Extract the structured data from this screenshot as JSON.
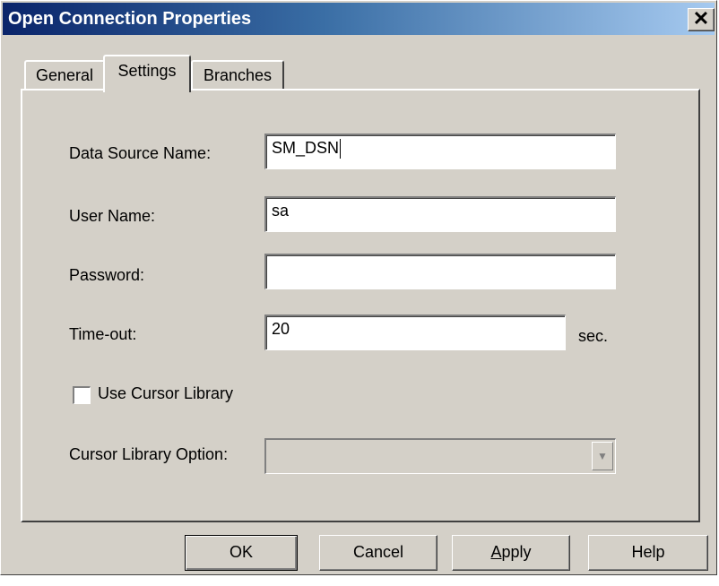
{
  "window": {
    "title": "Open Connection Properties",
    "close_glyph": "✕"
  },
  "tabs": [
    {
      "label": "General",
      "active": false
    },
    {
      "label": "Settings",
      "active": true
    },
    {
      "label": "Branches",
      "active": false
    }
  ],
  "form": {
    "dsn_label": "Data Source Name:",
    "dsn_value": "SM_DSN",
    "user_label": "User Name:",
    "user_value": "sa",
    "password_label": "Password:",
    "password_value": "",
    "timeout_label": "Time-out:",
    "timeout_value": "20",
    "timeout_unit": "sec.",
    "cursor_checkbox_label": "Use Cursor Library",
    "cursor_checkbox_checked": false,
    "cursor_option_label": "Cursor Library Option:",
    "cursor_option_value": ""
  },
  "buttons": {
    "ok": "OK",
    "cancel": "Cancel",
    "apply": "Apply",
    "help": "Help"
  },
  "colors": {
    "title_gradient_start": "#0a246a",
    "title_gradient_end": "#a6caf0",
    "dialog_face": "#d4d0c8"
  }
}
